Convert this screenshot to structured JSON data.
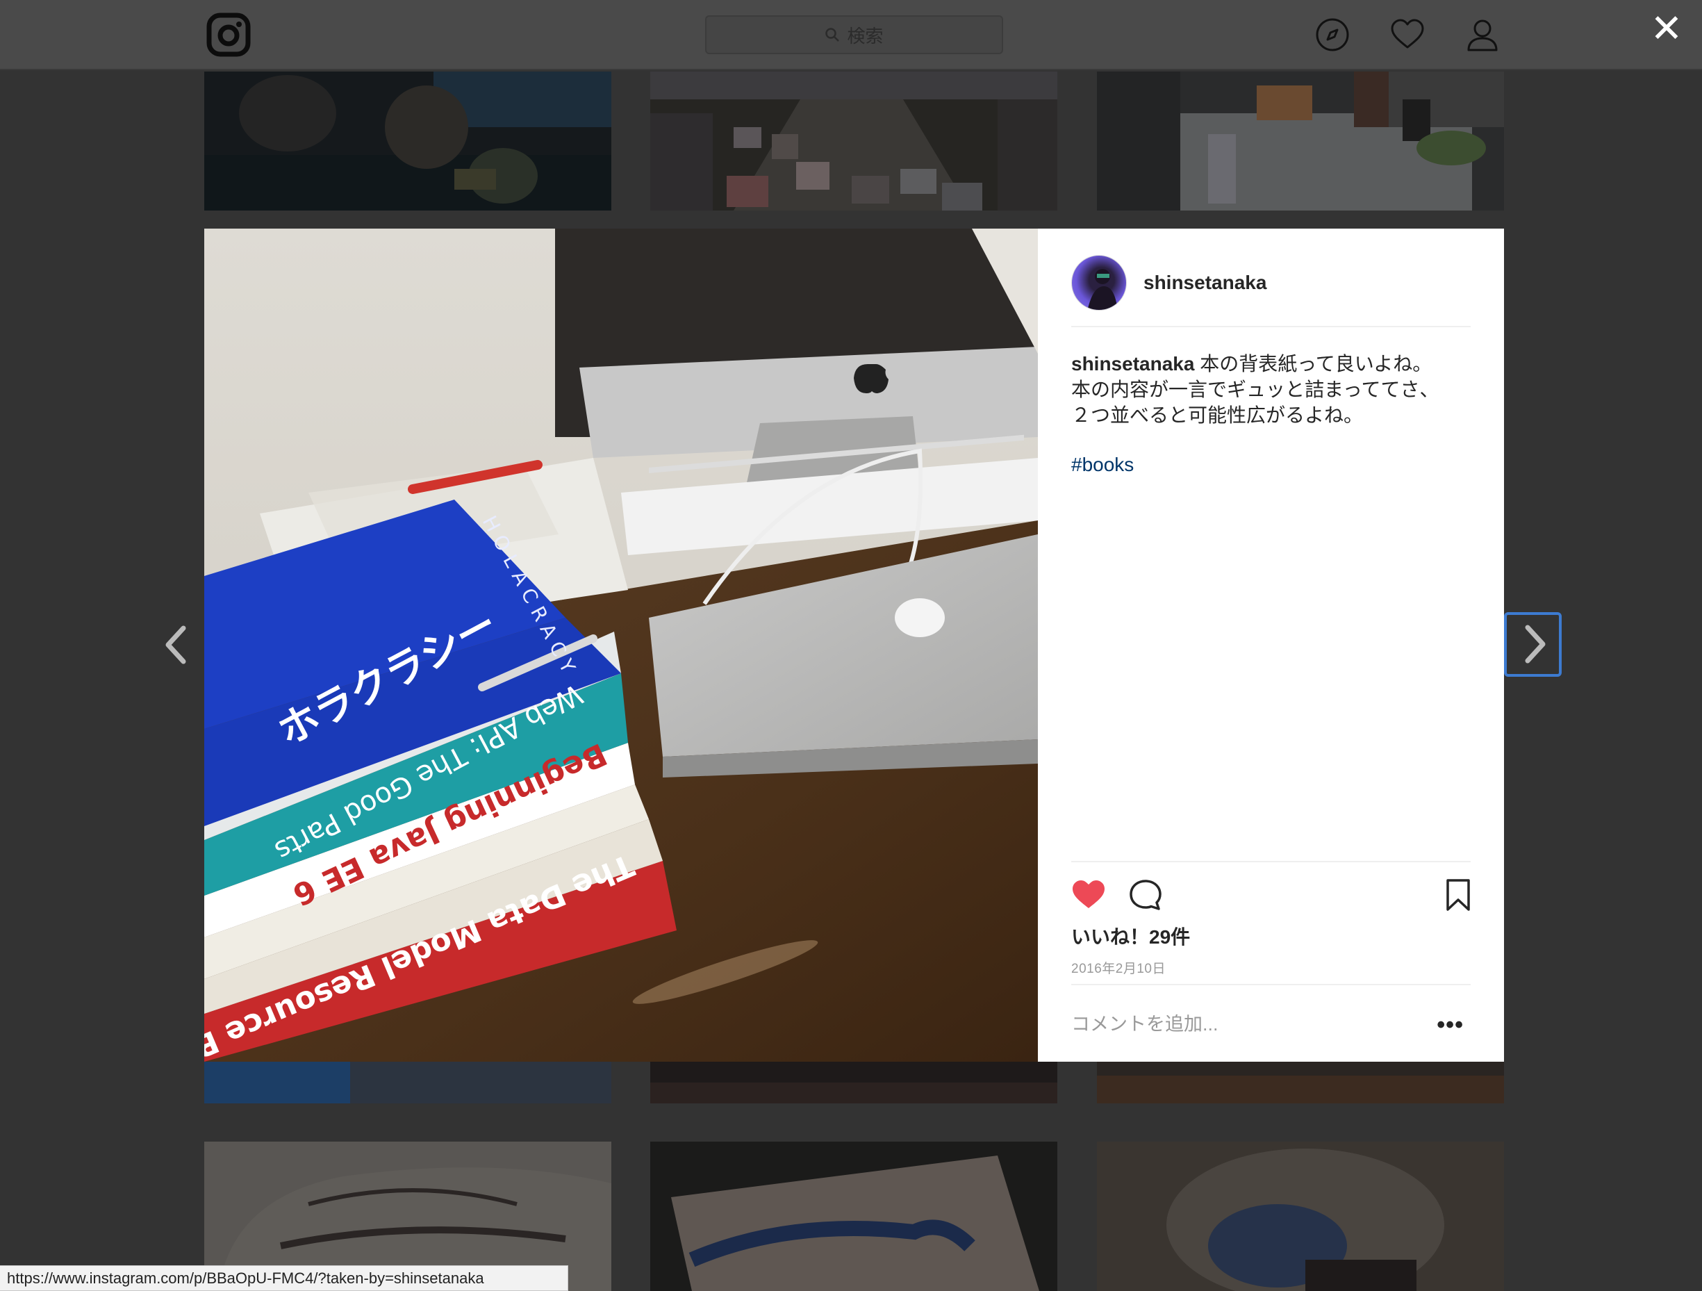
{
  "nav": {
    "search_placeholder": "検索",
    "icons": [
      "instagram-logo",
      "search-icon",
      "compass-icon",
      "heart-icon",
      "user-icon",
      "close-icon"
    ]
  },
  "post": {
    "username": "shinsetanaka",
    "caption_user": "shinsetanaka",
    "caption_lines": [
      "本の背表紙って良いよね。",
      "本の内容が一言でギュッと詰まっててさ、",
      "２つ並べると可能性広がるよね。"
    ],
    "hashtag": "#books",
    "likes": "いいね！29件",
    "date": "2016年2月10日",
    "comment_placeholder": "コメントを追加...",
    "liked": true,
    "like_color": "#ed4956"
  },
  "photo": {
    "book_spines": [
      "ホラクラシー",
      "HOLACRACY",
      "Web API: The Good Parts",
      "Beginning Java EE 6",
      "The Data Model Resource Book"
    ]
  },
  "status_url": "https://www.instagram.com/p/BBaOpU-FMC4/?taken-by=shinsetanaka"
}
